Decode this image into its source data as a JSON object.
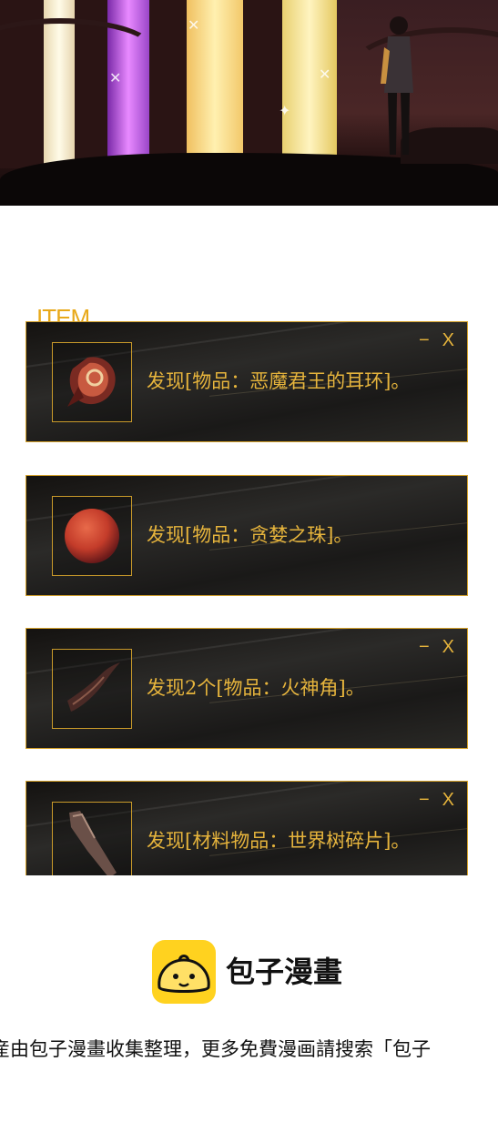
{
  "tag": "ITEM",
  "cards": [
    {
      "text": "发现[物品：恶魔君王的耳环]。",
      "minimize": "−",
      "close": "X",
      "icon": "earring-icon"
    },
    {
      "text": "发现[物品：贪婪之珠]。",
      "minimize": "",
      "close": "",
      "icon": "orb-icon"
    },
    {
      "text": "发现2个[物品：火神角]。",
      "minimize": "−",
      "close": "X",
      "icon": "horn-icon"
    },
    {
      "text": "发现[材料物品：世界树碎片]。",
      "minimize": "−",
      "close": "X",
      "icon": "shard-icon"
    }
  ],
  "footer": {
    "brand": "包子漫畫",
    "note": "産由包子漫畫收集整理，更多免費漫画請搜索「包子"
  },
  "colors": {
    "gold": "#e6b43c",
    "border": "#d4a12a",
    "logo_bg": "#ffd21f"
  }
}
